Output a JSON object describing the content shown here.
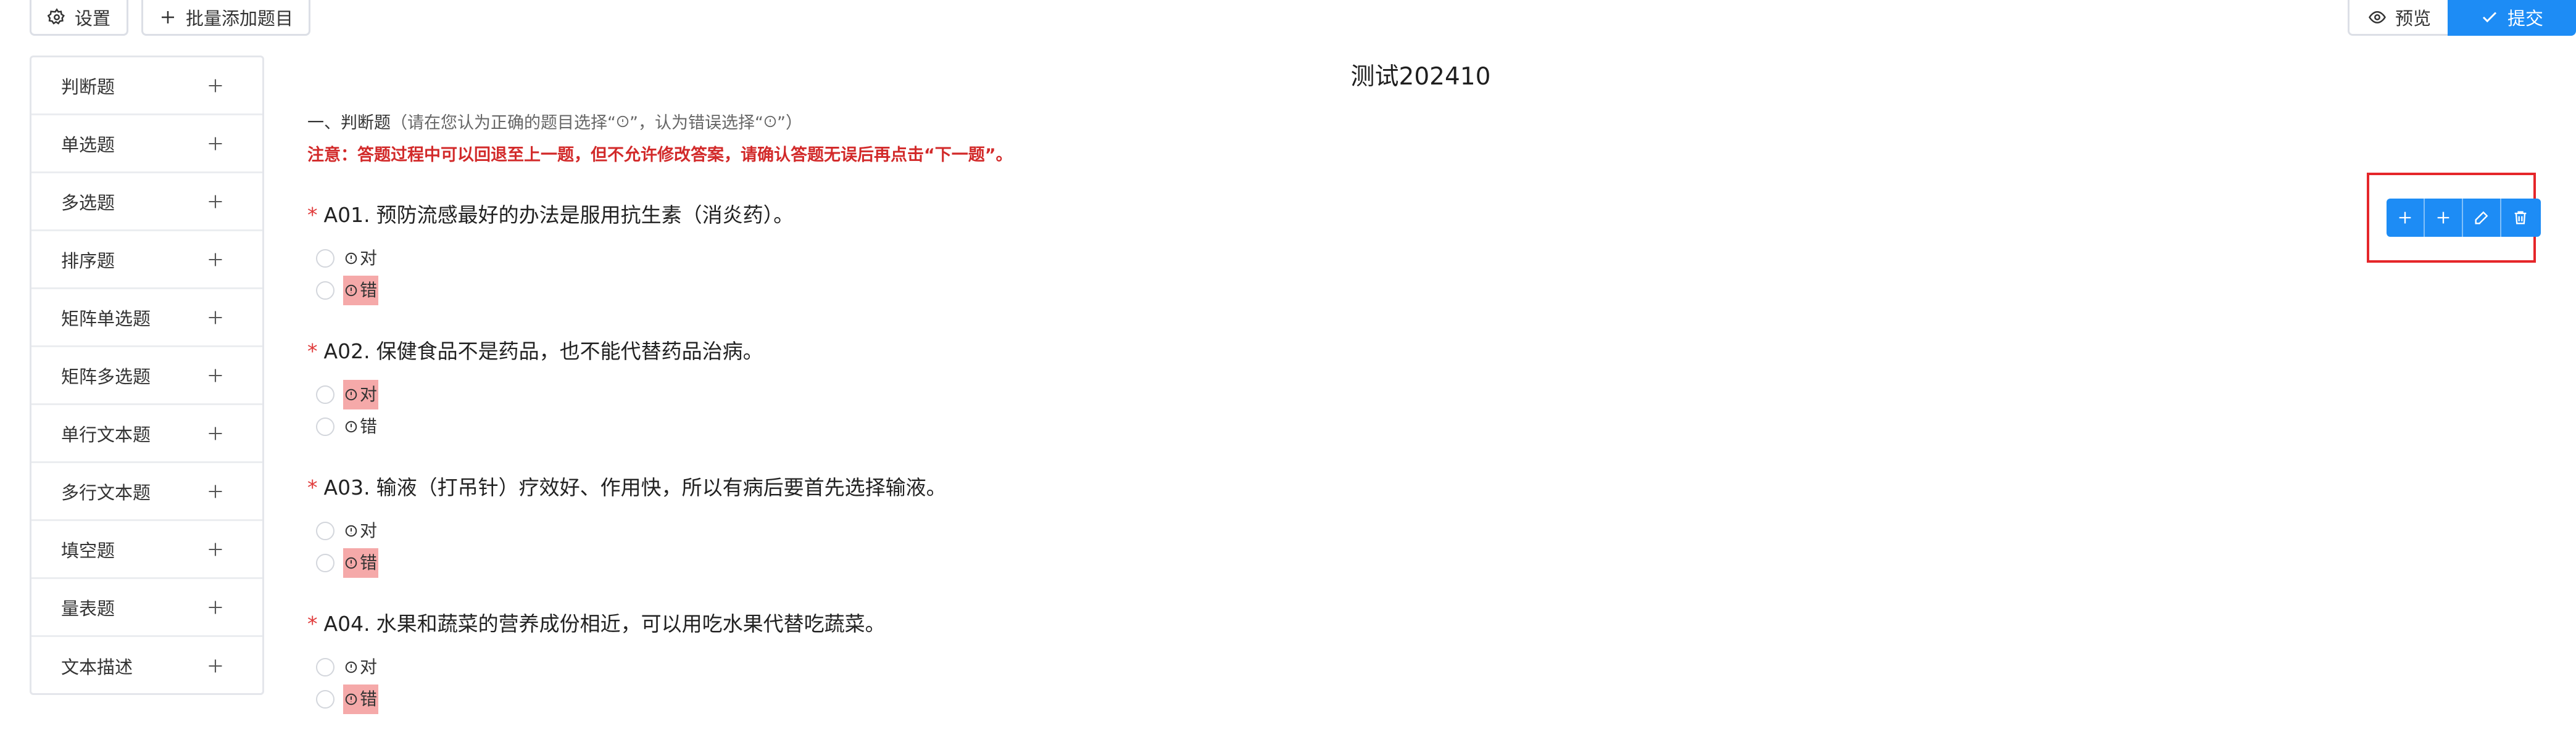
{
  "toolbar": {
    "settings_label": "设置",
    "batch_add_label": "批量添加题目",
    "preview_label": "预览",
    "submit_label": "提交"
  },
  "sidebar": {
    "items": [
      {
        "label": "判断题"
      },
      {
        "label": "单选题"
      },
      {
        "label": "多选题"
      },
      {
        "label": "排序题"
      },
      {
        "label": "矩阵单选题"
      },
      {
        "label": "矩阵多选题"
      },
      {
        "label": "单行文本题"
      },
      {
        "label": "多行文本题"
      },
      {
        "label": "填空题"
      },
      {
        "label": "量表题"
      },
      {
        "label": "文本描述"
      }
    ]
  },
  "survey": {
    "title": "测试202410",
    "section_title": "一、判断题",
    "section_hint": "（请在您认为正确的题目选择“",
    "section_hint_mid": "”，认为错误选择“",
    "section_hint_end": "”）",
    "notice": "注意：答题过程中可以回退至上一题，但不允许修改答案，请确认答题无误后再点击“下一题”。",
    "required_mark": "*",
    "questions": [
      {
        "number": "A01.",
        "text": "预防流感最好的办法是服用抗生素（消炎药）。",
        "options": [
          {
            "label": "对",
            "highlighted": false
          },
          {
            "label": "错",
            "highlighted": true
          }
        ]
      },
      {
        "number": "A02.",
        "text": "保健食品不是药品，也不能代替药品治病。",
        "options": [
          {
            "label": "对",
            "highlighted": true
          },
          {
            "label": "错",
            "highlighted": false
          }
        ]
      },
      {
        "number": "A03.",
        "text": "输液（打吊针）疗效好、作用快，所以有病后要首先选择输液。",
        "options": [
          {
            "label": "对",
            "highlighted": false
          },
          {
            "label": "错",
            "highlighted": true
          }
        ]
      },
      {
        "number": "A04.",
        "text": "水果和蔬菜的营养成份相近，可以用吃水果代替吃蔬菜。",
        "options": [
          {
            "label": "对",
            "highlighted": false
          },
          {
            "label": "错",
            "highlighted": true
          }
        ]
      }
    ]
  },
  "colors": {
    "accent": "#1d8cf5",
    "required": "#e03b3b",
    "notice": "#d22a2a",
    "highlight": "#f5a9a9",
    "selection_box": "#e5262a"
  },
  "icons": {
    "settings": "gear-icon",
    "batch_add": "plus-icon",
    "preview": "eye-icon",
    "submit": "check-icon",
    "actions": [
      "plus-icon",
      "plus-icon",
      "edit-icon",
      "trash-icon"
    ]
  }
}
